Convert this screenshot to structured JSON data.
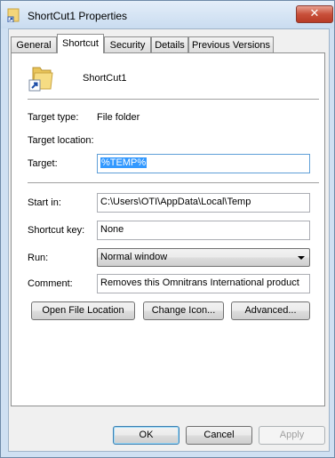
{
  "window": {
    "title": "ShortCut1 Properties",
    "close_glyph": "✕"
  },
  "tabs": [
    {
      "label": "General"
    },
    {
      "label": "Shortcut"
    },
    {
      "label": "Security"
    },
    {
      "label": "Details"
    },
    {
      "label": "Previous Versions"
    }
  ],
  "shortcut": {
    "name": "ShortCut1",
    "target_type_label": "Target type:",
    "target_type_value": "File folder",
    "target_location_label": "Target location:",
    "target_label": "Target:",
    "target_value": "%TEMP%",
    "start_in_label": "Start in:",
    "start_in_value": "C:\\Users\\OTI\\AppData\\Local\\Temp",
    "shortcut_key_label": "Shortcut key:",
    "shortcut_key_value": "None",
    "run_label": "Run:",
    "run_value": "Normal window",
    "comment_label": "Comment:",
    "comment_value": "Removes this Omnitrans International product"
  },
  "actions": {
    "open_file_location": "Open File Location",
    "change_icon": "Change Icon...",
    "advanced": "Advanced..."
  },
  "footer": {
    "ok": "OK",
    "cancel": "Cancel",
    "apply": "Apply"
  },
  "icons": {
    "title_icon": "folder-shortcut-icon",
    "main_icon": "folder-shortcut-icon"
  }
}
